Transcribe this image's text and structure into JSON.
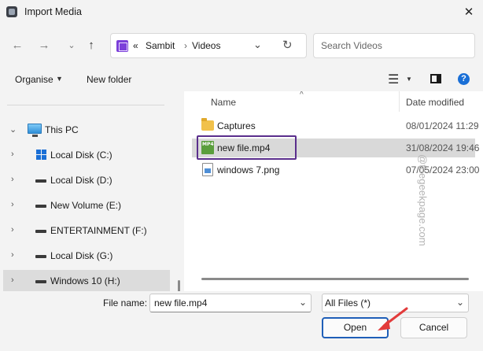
{
  "window": {
    "title": "Import Media"
  },
  "nav": {
    "back_icon": "arrow-left-icon",
    "forward_icon": "arrow-right-icon",
    "history_icon": "chevron-down-icon",
    "up_icon": "arrow-up-icon"
  },
  "address": {
    "overflow": "«",
    "crumbs": [
      "Sambit",
      "Videos"
    ],
    "separator": "›",
    "refresh_icon": "refresh-icon"
  },
  "search": {
    "placeholder": "Search Videos"
  },
  "toolbar": {
    "organise": "Organise",
    "new_folder": "New folder"
  },
  "sidebar": {
    "items": [
      {
        "label": "This PC",
        "icon": "pc-icon"
      },
      {
        "label": "Local Disk (C:)",
        "icon": "windows-drive-icon"
      },
      {
        "label": "Local Disk (D:)",
        "icon": "drive-icon"
      },
      {
        "label": "New Volume (E:)",
        "icon": "drive-icon"
      },
      {
        "label": "ENTERTAINMENT (F:)",
        "icon": "drive-icon"
      },
      {
        "label": "Local Disk (G:)",
        "icon": "drive-icon"
      },
      {
        "label": "Windows 10 (H:)",
        "icon": "drive-icon",
        "selected": true
      }
    ]
  },
  "files": {
    "columns": {
      "name": "Name",
      "date": "Date modified"
    },
    "rows": [
      {
        "name": "Captures",
        "date": "08/01/2024 11:29",
        "icon": "folder-icon"
      },
      {
        "name": "new file.mp4",
        "date": "31/08/2024 19:46",
        "icon": "mp4-file-icon",
        "mp4_tag": "MP4",
        "selected": true
      },
      {
        "name": "windows 7.png",
        "date": "07/05/2024 23:00",
        "icon": "png-file-icon"
      }
    ]
  },
  "watermark": "@thegeekpage.com",
  "footer": {
    "file_name_label": "File name:",
    "file_name_value": "new file.mp4",
    "file_type_value": "All Files (*)",
    "open": "Open",
    "cancel": "Cancel"
  },
  "colors": {
    "accent": "#1f5fb8",
    "highlight_box": "#5a2e8c",
    "arrow": "#e23b3b"
  }
}
